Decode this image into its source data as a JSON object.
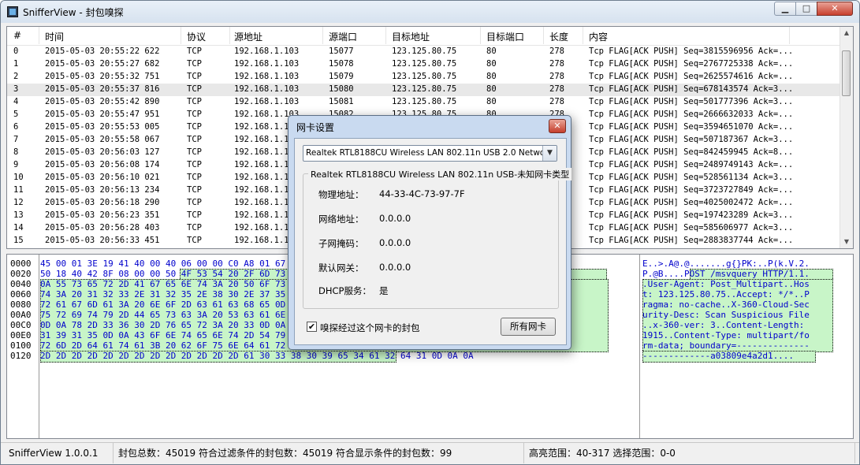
{
  "window": {
    "title": "SnifferView - 封包嗅探",
    "min_label": "▁",
    "max_label": "□",
    "close_label": "✕"
  },
  "list": {
    "columns": [
      "#",
      "时间",
      "协议",
      "源地址",
      "源端口",
      "目标地址",
      "目标端口",
      "长度",
      "内容"
    ],
    "rows": [
      [
        "0",
        "2015-05-03 20:55:22 622",
        "TCP",
        "192.168.1.103",
        "15077",
        "123.125.80.75",
        "80",
        "278",
        "Tcp FLAG[ACK PUSH] Seq=3815596956 Ack=..."
      ],
      [
        "1",
        "2015-05-03 20:55:27 682",
        "TCP",
        "192.168.1.103",
        "15078",
        "123.125.80.75",
        "80",
        "278",
        "Tcp FLAG[ACK PUSH] Seq=2767725338 Ack=..."
      ],
      [
        "2",
        "2015-05-03 20:55:32 751",
        "TCP",
        "192.168.1.103",
        "15079",
        "123.125.80.75",
        "80",
        "278",
        "Tcp FLAG[ACK PUSH] Seq=2625574616 Ack=..."
      ],
      [
        "3",
        "2015-05-03 20:55:37 816",
        "TCP",
        "192.168.1.103",
        "15080",
        "123.125.80.75",
        "80",
        "278",
        "Tcp FLAG[ACK PUSH] Seq=678143574 Ack=3..."
      ],
      [
        "4",
        "2015-05-03 20:55:42 890",
        "TCP",
        "192.168.1.103",
        "15081",
        "123.125.80.75",
        "80",
        "278",
        "Tcp FLAG[ACK PUSH] Seq=501777396 Ack=3..."
      ],
      [
        "5",
        "2015-05-03 20:55:47 951",
        "TCP",
        "192.168.1.103",
        "15082",
        "123.125.80.75",
        "80",
        "278",
        "Tcp FLAG[ACK PUSH] Seq=2666632033 Ack=..."
      ],
      [
        "6",
        "2015-05-03 20:55:53 005",
        "TCP",
        "192.168.1.103",
        "15083",
        "123.125.80.75",
        "80",
        "278",
        "Tcp FLAG[ACK PUSH] Seq=3594651070 Ack=..."
      ],
      [
        "7",
        "2015-05-03 20:55:58 067",
        "TCP",
        "192.168.1.103",
        "15084",
        "123.125.80.75",
        "80",
        "278",
        "Tcp FLAG[ACK PUSH] Seq=507187367 Ack=3..."
      ],
      [
        "8",
        "2015-05-03 20:56:03 127",
        "TCP",
        "192.168.1.103",
        "15085",
        "123.125.80.75",
        "80",
        "278",
        "Tcp FLAG[ACK PUSH] Seq=842459945 Ack=8..."
      ],
      [
        "9",
        "2015-05-03 20:56:08 174",
        "TCP",
        "192.168.1.103",
        "15086",
        "123.125.80.75",
        "80",
        "278",
        "Tcp FLAG[ACK PUSH] Seq=2489749143 Ack=..."
      ],
      [
        "10",
        "2015-05-03 20:56:10 021",
        "TCP",
        "192.168.1.103",
        "15087",
        "123.125.80.75",
        "80",
        "278",
        "Tcp FLAG[ACK PUSH] Seq=528561134 Ack=3..."
      ],
      [
        "11",
        "2015-05-03 20:56:13 234",
        "TCP",
        "192.168.1.103",
        "15088",
        "123.125.80.75",
        "80",
        "278",
        "Tcp FLAG[ACK PUSH] Seq=3723727849 Ack=..."
      ],
      [
        "12",
        "2015-05-03 20:56:18 290",
        "TCP",
        "192.168.1.103",
        "15089",
        "123.125.80.75",
        "80",
        "278",
        "Tcp FLAG[ACK PUSH] Seq=4025002472 Ack=..."
      ],
      [
        "13",
        "2015-05-03 20:56:23 351",
        "TCP",
        "192.168.1.103",
        "15090",
        "123.125.80.75",
        "80",
        "278",
        "Tcp FLAG[ACK PUSH] Seq=197423289 Ack=3..."
      ],
      [
        "14",
        "2015-05-03 20:56:28 403",
        "TCP",
        "192.168.1.103",
        "15091",
        "123.125.80.75",
        "80",
        "278",
        "Tcp FLAG[ACK PUSH] Seq=585606977 Ack=3..."
      ],
      [
        "15",
        "2015-05-03 20:56:33 451",
        "TCP",
        "192.168.1.103",
        "15092",
        "123.125.80.75",
        "80",
        "278",
        "Tcp FLAG[ACK PUSH] Seq=2883837744 Ack=..."
      ]
    ],
    "selected_row": 3
  },
  "hex": {
    "offsets": [
      "0000",
      "0020",
      "0040",
      "0060",
      "0080",
      "00A0",
      "00C0",
      "00E0",
      "0100",
      "0120"
    ],
    "lines": [
      "45 00 01 3E 19 41 40 00 40 06 00 00 C0 A8 01 67 7B 7D 50 4B 3A E5 00 50 E0 4E 4B 28 EB 32 0C E1",
      "50 18 40 42 8F 08 00 00 50 4F 53 54 20 2F 6D 73 76 71 75 65 72 79 20 48 54 54 50 2F 31 2E 31 0D",
      "0A 55 73 65 72 2D 41 67 65 6E 74 3A 20 50 6F 73 74 5F 4D 75 6C 74 69 70 61 72 74 0D 0A 48 6F 73",
      "74 3A 20 31 32 33 2E 31 32 35 2E 38 30 2E 37 35 0D 0A 41 63 63 65 70 74 3A 20 2A 2F 2A 0D 0A 50",
      "72 61 67 6D 61 3A 20 6E 6F 2D 63 61 63 68 65 0D 0A 58 2D 33 36 30 2D 43 6C 6F 75 64 2D 53 65 63",
      "75 72 69 74 79 2D 44 65 73 63 3A 20 53 63 61 6E 20 53 75 73 70 69 63 69 6F 75 73 20 46 69 6C 65",
      "0D 0A 78 2D 33 36 30 2D 76 65 72 3A 20 33 0D 0A 43 6F 6E 74 65 6E 74 2D 4C 65 6E 67 74 68 3A 20",
      "31 39 31 35 0D 0A 43 6F 6E 74 65 6E 74 2D 54 79 70 65 3A 20 6D 75 6C 74 69 70 61 72 74 2F 66 6F",
      "72 6D 2D 64 61 74 61 3B 20 62 6F 75 6E 64 61 72 79 3D 2D 2D 2D 2D 2D 2D 2D 2D 2D 2D 2D 2D 2D 2D",
      "2D 2D 2D 2D 2D 2D 2D 2D 2D 2D 2D 2D 2D 61 30 33 38 30 39 65 34 61 32 64 31 0D 0A 0A"
    ],
    "ascii": [
      "E..>.A@.@.......g{}PK:..P(k.V.2.",
      "P.@B....POST /msvquery HTTP/1.1.",
      ".User-Agent: Post_Multipart..Hos",
      "t: 123.125.80.75..Accept: */*..P",
      "ragma: no-cache..X-360-Cloud-Sec",
      "urity-Desc: Scan Suspicious File",
      "..x-360-ver: 3..Content-Length: ",
      "1915..Content-Type: multipart/fo",
      "rm-data; boundary=--------------",
      "-------------a03809e4a2d1...."
    ],
    "highlight_color": "#c8f5c8"
  },
  "status": {
    "app": "SnifferView  1.0.0.1",
    "counts": "封包总数：45019  符合过滤条件的封包数：45019  符合显示条件的封包数：99",
    "range": "高亮范围：40-317  选择范围：0-0"
  },
  "dialog": {
    "title": "网卡设置",
    "close_label": "✕",
    "adapter_selected": "Realtek RTL8188CU Wireless LAN 802.11n USB 2.0 Network Adapter",
    "group_title": "Realtek RTL8188CU Wireless LAN 802.11n USB-未知网卡类型",
    "fields": [
      {
        "label": "物理地址：",
        "value": "44-33-4C-73-97-7F"
      },
      {
        "label": "网络地址：",
        "value": "0.0.0.0"
      },
      {
        "label": "子网掩码：",
        "value": "0.0.0.0"
      },
      {
        "label": "默认网关：",
        "value": "0.0.0.0"
      },
      {
        "label": "DHCP服务：",
        "value": "是"
      }
    ],
    "checkbox_label": "嗅探经过这个网卡的封包",
    "checkbox_checked": "✔",
    "all_adapters_button": "所有网卡"
  }
}
